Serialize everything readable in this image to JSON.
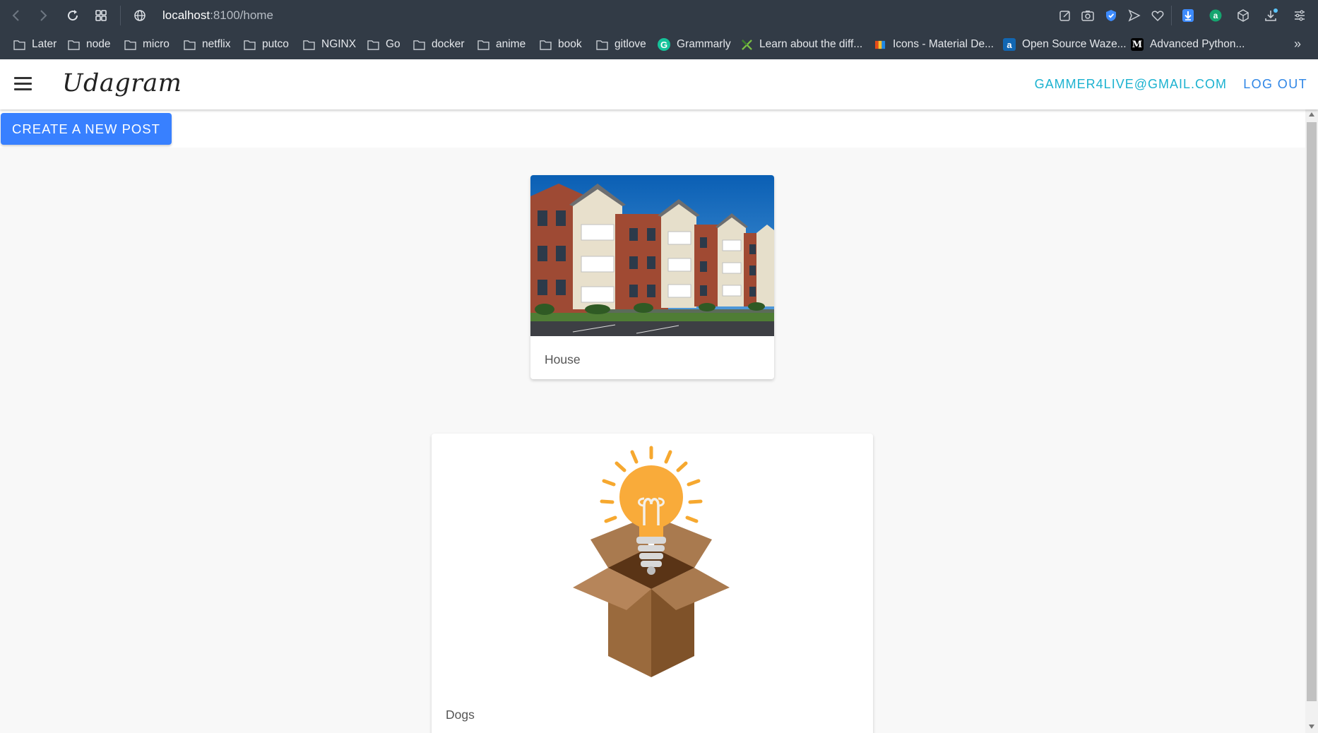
{
  "browser": {
    "url_host": "localhost",
    "url_path": ":8100/home",
    "bookmarks": [
      {
        "label": "Later",
        "icon": "folder-icon"
      },
      {
        "label": "node",
        "icon": "folder-icon"
      },
      {
        "label": "micro",
        "icon": "folder-icon"
      },
      {
        "label": "netflix",
        "icon": "folder-icon"
      },
      {
        "label": "putco",
        "icon": "folder-icon"
      },
      {
        "label": "NGINX",
        "icon": "folder-icon"
      },
      {
        "label": "Go",
        "icon": "folder-icon"
      },
      {
        "label": "docker",
        "icon": "folder-icon"
      },
      {
        "label": "anime",
        "icon": "folder-icon"
      },
      {
        "label": "book",
        "icon": "folder-icon"
      },
      {
        "label": "gitlove",
        "icon": "folder-icon"
      },
      {
        "label": "Grammarly",
        "icon": "grammarly-icon"
      },
      {
        "label": "Learn about the diff...",
        "icon": "x-favicon"
      },
      {
        "label": "Icons - Material De...",
        "icon": "material-favicon"
      },
      {
        "label": "Open Source Waze...",
        "icon": "a-favicon"
      },
      {
        "label": "Advanced Python...",
        "icon": "medium-favicon"
      }
    ],
    "favicon_glyphs": {
      "grammarly": "G",
      "a": "a",
      "medium": "M"
    }
  },
  "app": {
    "brand": "Udagram",
    "user_email": "GAMMER4LIVE@GMAIL.COM",
    "logout_label": "LOG OUT",
    "create_post_label": "CREATE A NEW POST",
    "colors": {
      "primary": "#3880ff",
      "email": "#1bb2d0",
      "logout": "#2f86e6"
    }
  },
  "posts": [
    {
      "caption": "House",
      "image": "apartment-building-photo"
    },
    {
      "caption": "Dogs",
      "image": "lightbulb-in-box-illustration"
    }
  ]
}
